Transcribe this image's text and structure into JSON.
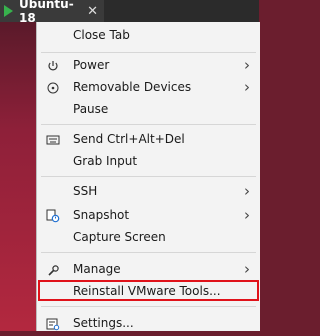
{
  "tab": {
    "title": "Ubuntu-18",
    "close": "✕"
  },
  "menu": {
    "close_tab": "Close Tab",
    "power": "Power",
    "removable_devices": "Removable Devices",
    "pause": "Pause",
    "send_cad": "Send Ctrl+Alt+Del",
    "grab_input": "Grab Input",
    "ssh": "SSH",
    "snapshot": "Snapshot",
    "capture_screen": "Capture Screen",
    "manage": "Manage",
    "reinstall_tools": "Reinstall VMware Tools...",
    "settings": "Settings..."
  },
  "colors": {
    "highlight_border": "#e0121a",
    "play_icon": "#37b24d"
  }
}
